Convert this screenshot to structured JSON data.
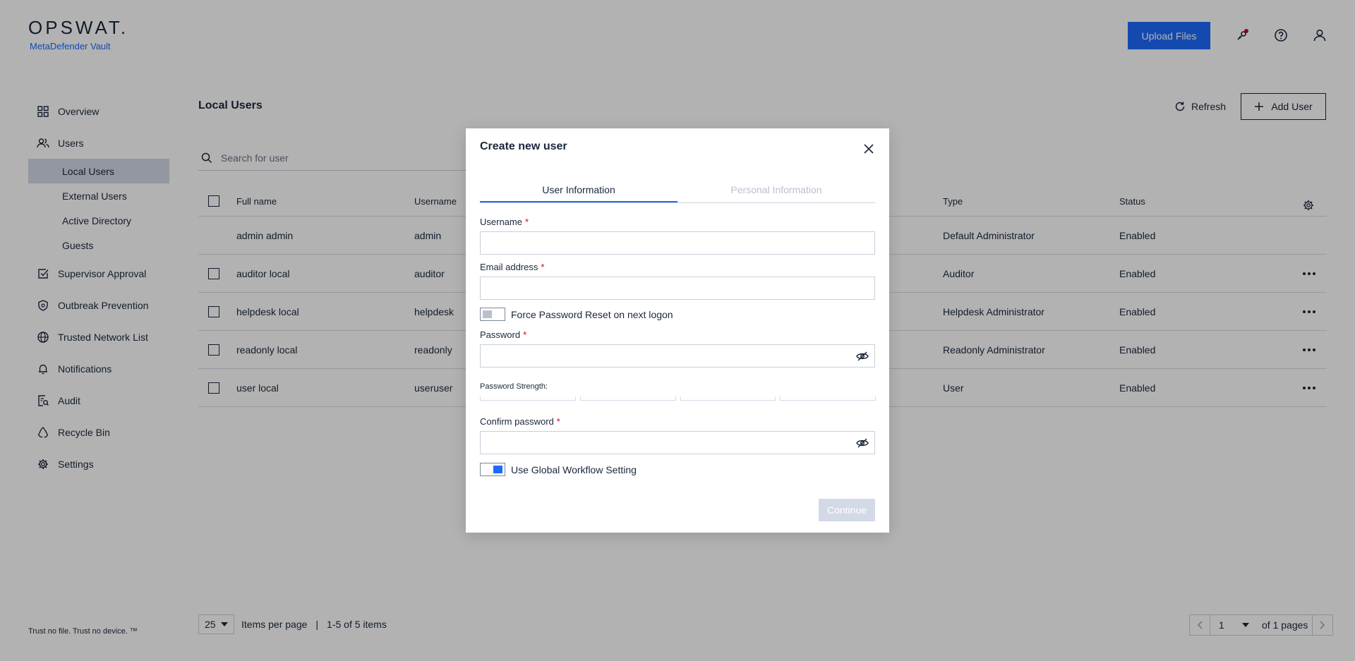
{
  "header": {
    "logo": "OPSWAT.",
    "product": "MetaDefender Vault",
    "upload_label": "Upload Files"
  },
  "sidebar": {
    "items": [
      {
        "label": "Overview",
        "icon": "grid-icon"
      },
      {
        "label": "Users",
        "icon": "users-icon"
      },
      {
        "label": "Supervisor Approval",
        "icon": "approval-icon"
      },
      {
        "label": "Outbreak Prevention",
        "icon": "shield-icon"
      },
      {
        "label": "Trusted Network List",
        "icon": "globe-icon"
      },
      {
        "label": "Notifications",
        "icon": "bell-icon"
      },
      {
        "label": "Audit",
        "icon": "audit-icon"
      },
      {
        "label": "Recycle Bin",
        "icon": "recycle-icon"
      },
      {
        "label": "Settings",
        "icon": "gear-icon"
      }
    ],
    "user_subitems": [
      "Local Users",
      "External Users",
      "Active Directory",
      "Guests"
    ],
    "active_subitem": "Local Users",
    "tagline": "Trust no file. Trust no device. ™"
  },
  "main": {
    "title": "Local Users",
    "refresh_label": "Refresh",
    "add_user_label": "Add User",
    "search_placeholder": "Search for user",
    "columns": [
      "Full name",
      "Username",
      "Type",
      "Status"
    ],
    "rows": [
      {
        "full_name": "admin admin",
        "username": "admin",
        "type": "Default Administrator",
        "status": "Enabled"
      },
      {
        "full_name": "auditor local",
        "username": "auditor",
        "type": "Auditor",
        "status": "Enabled"
      },
      {
        "full_name": "helpdesk local",
        "username": "helpdesk",
        "type": "Helpdesk Administrator",
        "status": "Enabled"
      },
      {
        "full_name": "readonly local",
        "username": "readonly",
        "type": "Readonly Administrator",
        "status": "Enabled"
      },
      {
        "full_name": "user local",
        "username": "useruser",
        "type": "User",
        "status": "Enabled"
      }
    ],
    "per_page": "25",
    "per_page_label": "Items per page",
    "separator": "|",
    "range_label": "1-5 of 5 items",
    "page": "1",
    "pages_label": "of 1 pages"
  },
  "modal": {
    "title": "Create new user",
    "tabs": [
      "User Information",
      "Personal Information"
    ],
    "username_label": "Username",
    "email_label": "Email address",
    "required_mark": "*",
    "force_reset_label": "Force Password Reset on next logon",
    "force_reset_on": false,
    "password_label": "Password",
    "strength_label": "Password Strength:",
    "confirm_label": "Confirm password",
    "global_workflow_label": "Use Global Workflow Setting",
    "global_workflow_on": true,
    "continue_label": "Continue"
  },
  "colors": {
    "accent": "#1d6bfc",
    "required": "#d0021b",
    "disabled": "#d3d9e6",
    "text": "#1b273c"
  }
}
